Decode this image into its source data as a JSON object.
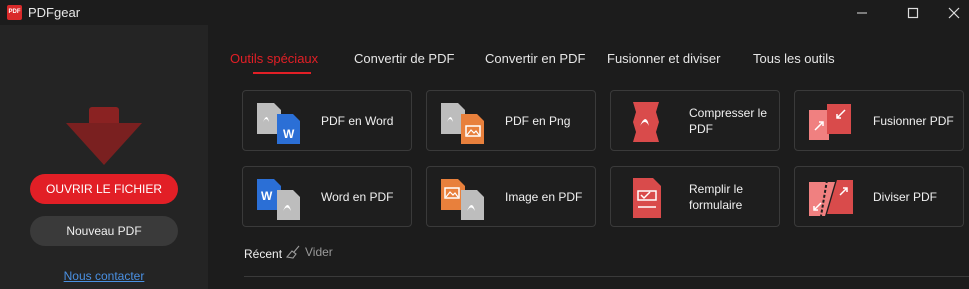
{
  "app": {
    "title": "PDFgear",
    "logo_text": "PDF"
  },
  "sidebar": {
    "open_label": "OUVRIR LE FICHIER",
    "new_label": "Nouveau PDF",
    "contact_label": "Nous contacter"
  },
  "tabs": [
    {
      "label": "Outils spéciaux",
      "active": true
    },
    {
      "label": "Convertir de PDF",
      "active": false
    },
    {
      "label": "Convertir en PDF",
      "active": false
    },
    {
      "label": "Fusionner et diviser",
      "active": false
    },
    {
      "label": "Tous les outils",
      "active": false
    }
  ],
  "tools": [
    {
      "label": "PDF en Word",
      "icon": "pdf-to-word-icon"
    },
    {
      "label": "PDF en Png",
      "icon": "pdf-to-png-icon"
    },
    {
      "label": "Compresser le PDF",
      "icon": "compress-pdf-icon"
    },
    {
      "label": "Fusionner PDF",
      "icon": "merge-pdf-icon"
    },
    {
      "label": "Word en PDF",
      "icon": "word-to-pdf-icon"
    },
    {
      "label": "Image en PDF",
      "icon": "image-to-pdf-icon"
    },
    {
      "label": "Remplir le formulaire",
      "icon": "fill-form-icon"
    },
    {
      "label": "Diviser PDF",
      "icon": "split-pdf-icon"
    }
  ],
  "recent": {
    "title": "Récent",
    "clear_label": "Vider"
  },
  "colors": {
    "accent": "#e21f26",
    "word_blue": "#2b6fd6",
    "image_orange": "#e8803c",
    "pdf_red": "#d94b4b"
  }
}
